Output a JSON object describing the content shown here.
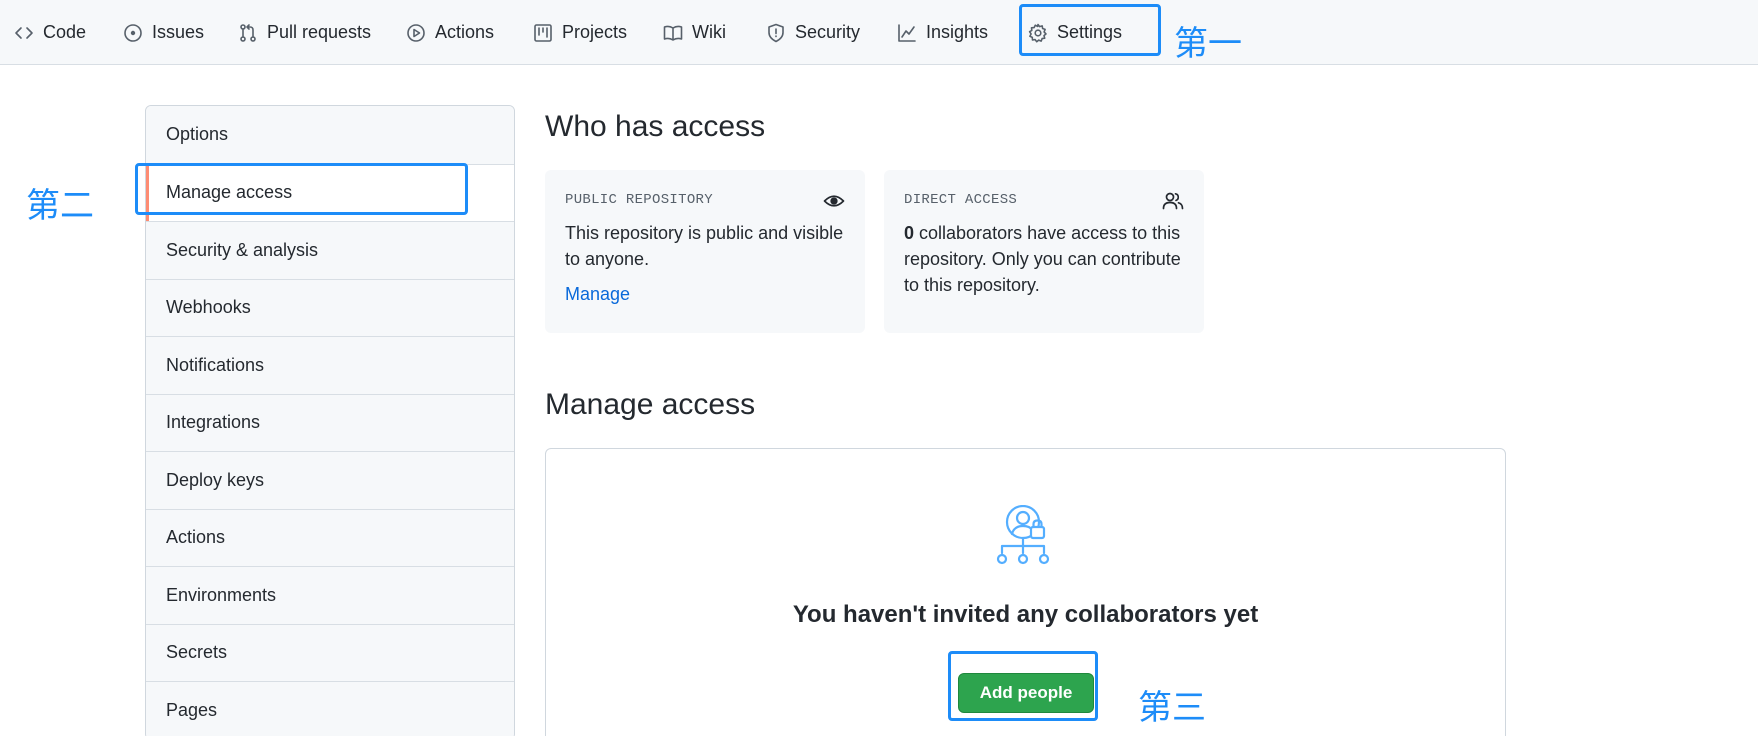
{
  "nav": {
    "items": [
      {
        "label": "Code",
        "icon": "code-icon"
      },
      {
        "label": "Issues",
        "icon": "issue-icon"
      },
      {
        "label": "Pull requests",
        "icon": "pull-request-icon"
      },
      {
        "label": "Actions",
        "icon": "play-icon"
      },
      {
        "label": "Projects",
        "icon": "project-icon"
      },
      {
        "label": "Wiki",
        "icon": "book-icon"
      },
      {
        "label": "Security",
        "icon": "shield-icon"
      },
      {
        "label": "Insights",
        "icon": "graph-icon"
      },
      {
        "label": "Settings",
        "icon": "gear-icon"
      }
    ]
  },
  "annotations": {
    "step1": "第一",
    "step2": "第二",
    "step3": "第三",
    "color": "#1d8cf8"
  },
  "sidebar": {
    "items": [
      {
        "label": "Options"
      },
      {
        "label": "Manage access",
        "selected": true
      },
      {
        "label": "Security & analysis"
      },
      {
        "label": "Webhooks"
      },
      {
        "label": "Notifications"
      },
      {
        "label": "Integrations"
      },
      {
        "label": "Deploy keys"
      },
      {
        "label": "Actions"
      },
      {
        "label": "Environments"
      },
      {
        "label": "Secrets"
      },
      {
        "label": "Pages"
      }
    ]
  },
  "main": {
    "who_title": "Who has access",
    "public_card": {
      "label": "PUBLIC REPOSITORY",
      "icon": "eye-icon",
      "text": "This repository is public and visible to anyone.",
      "link": "Manage"
    },
    "direct_card": {
      "label": "DIRECT ACCESS",
      "icon": "people-icon",
      "count": "0",
      "text": " collaborators have access to this repository. Only you can contribute to this repository."
    },
    "manage_title": "Manage access",
    "empty_icon": "person-lock-icon",
    "empty_title": "You haven't invited any collaborators yet",
    "add_button": "Add people"
  },
  "colors": {
    "accent_link": "#0969da",
    "primary_button": "#2da44e",
    "selected_indicator": "#fd8c73"
  }
}
